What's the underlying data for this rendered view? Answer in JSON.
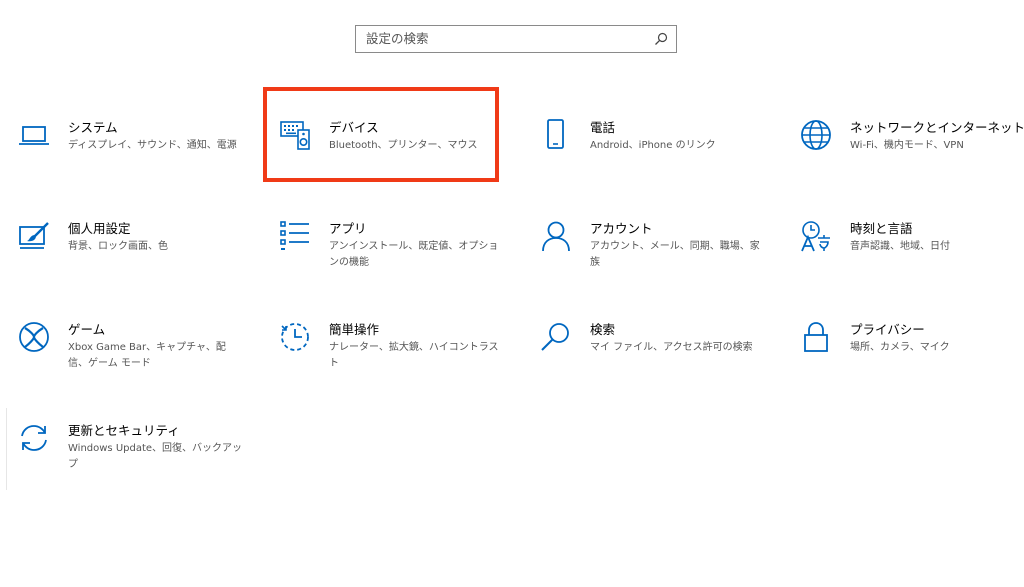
{
  "search": {
    "placeholder": "設定の検索",
    "value": ""
  },
  "accent_color": "#0067c0",
  "highlight_color": "#f03a17",
  "tiles": [
    {
      "id": "system",
      "title": "システム",
      "desc": "ディスプレイ、サウンド、通知、電源",
      "icon": "laptop-icon"
    },
    {
      "id": "devices",
      "title": "デバイス",
      "desc": "Bluetooth、プリンター、マウス",
      "icon": "devices-icon"
    },
    {
      "id": "phone",
      "title": "電話",
      "desc": "Android、iPhone のリンク",
      "icon": "phone-icon"
    },
    {
      "id": "network",
      "title": "ネットワークとインターネット",
      "desc": "Wi-Fi、機内モード、VPN",
      "icon": "globe-icon"
    },
    {
      "id": "personalization",
      "title": "個人用設定",
      "desc": "背景、ロック画面、色",
      "icon": "paintbrush-icon"
    },
    {
      "id": "apps",
      "title": "アプリ",
      "desc": "アンインストール、既定値、オプションの機能",
      "icon": "apps-list-icon"
    },
    {
      "id": "accounts",
      "title": "アカウント",
      "desc": "アカウント、メール、同期、職場、家族",
      "icon": "person-icon"
    },
    {
      "id": "time-language",
      "title": "時刻と言語",
      "desc": "音声認識、地域、日付",
      "icon": "time-language-icon"
    },
    {
      "id": "gaming",
      "title": "ゲーム",
      "desc": "Xbox Game Bar、キャプチャ、配信、ゲーム モード",
      "icon": "xbox-icon"
    },
    {
      "id": "ease-of-access",
      "title": "簡単操作",
      "desc": "ナレーター、拡大鏡、ハイコントラスト",
      "icon": "ease-of-access-icon"
    },
    {
      "id": "search-settings",
      "title": "検索",
      "desc": "マイ ファイル、アクセス許可の検索",
      "icon": "magnifier-icon"
    },
    {
      "id": "privacy",
      "title": "プライバシー",
      "desc": "場所、カメラ、マイク",
      "icon": "lock-icon"
    },
    {
      "id": "update-security",
      "title": "更新とセキュリティ",
      "desc": "Windows Update、回復、バックアップ",
      "icon": "refresh-icon"
    }
  ]
}
